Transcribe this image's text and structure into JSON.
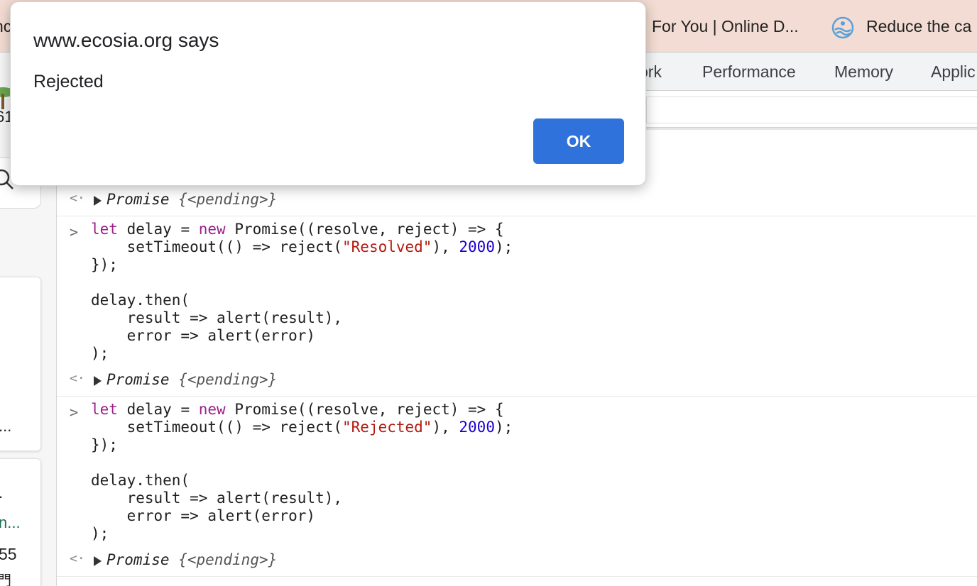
{
  "browser": {
    "tabs": [
      {
        "label": "nc"
      },
      {
        "label": "For You | Online D..."
      },
      {
        "label": "Reduce the ca"
      }
    ]
  },
  "devtools": {
    "tabs": [
      {
        "label": "ork"
      },
      {
        "label": "Performance"
      },
      {
        "label": "Memory"
      },
      {
        "label": "Applic"
      }
    ]
  },
  "page_fragments": {
    "logo_text": "61",
    "ellipsis_1": "...",
    "dot": ".",
    "green_text": "n...",
    "number": "55",
    "cjk": "門"
  },
  "console": {
    "results": [
      {
        "label": "Promise",
        "value": "{<pending>}"
      },
      {
        "label": "Promise",
        "value": "{<pending>}"
      },
      {
        "label": "Promise",
        "value": "{<pending>}"
      }
    ],
    "inputs": [
      {
        "line1_kw": "let",
        "line1_a": " delay = ",
        "line1_kw2": "new",
        "line1_b": " Promise((resolve, reject) => {",
        "line2_a": "    setTimeout(() => reject(",
        "line2_str": "\"Resolved\"",
        "line2_b": "), ",
        "line2_num": "2000",
        "line2_c": ");",
        "line3": "});",
        "line4": "delay.then(",
        "line5": "    result => alert(result),",
        "line6": "    error => alert(error)",
        "line7": ");"
      },
      {
        "line1_kw": "let",
        "line1_a": " delay = ",
        "line1_kw2": "new",
        "line1_b": " Promise((resolve, reject) => {",
        "line2_a": "    setTimeout(() => reject(",
        "line2_str": "\"Rejected\"",
        "line2_b": "), ",
        "line2_num": "2000",
        "line2_c": ");",
        "line3": "});",
        "line4": "delay.then(",
        "line5": "    result => alert(result),",
        "line6": "    error => alert(error)",
        "line7": ");"
      }
    ]
  },
  "dialog": {
    "title": "www.ecosia.org says",
    "message": "Rejected",
    "ok_label": "OK"
  },
  "colors": {
    "tabstrip_bg": "#f3dcd3",
    "ok_button": "#2f72dc",
    "keyword": "#9b1f8b",
    "string": "#b21a10",
    "number": "#1c00cf"
  }
}
